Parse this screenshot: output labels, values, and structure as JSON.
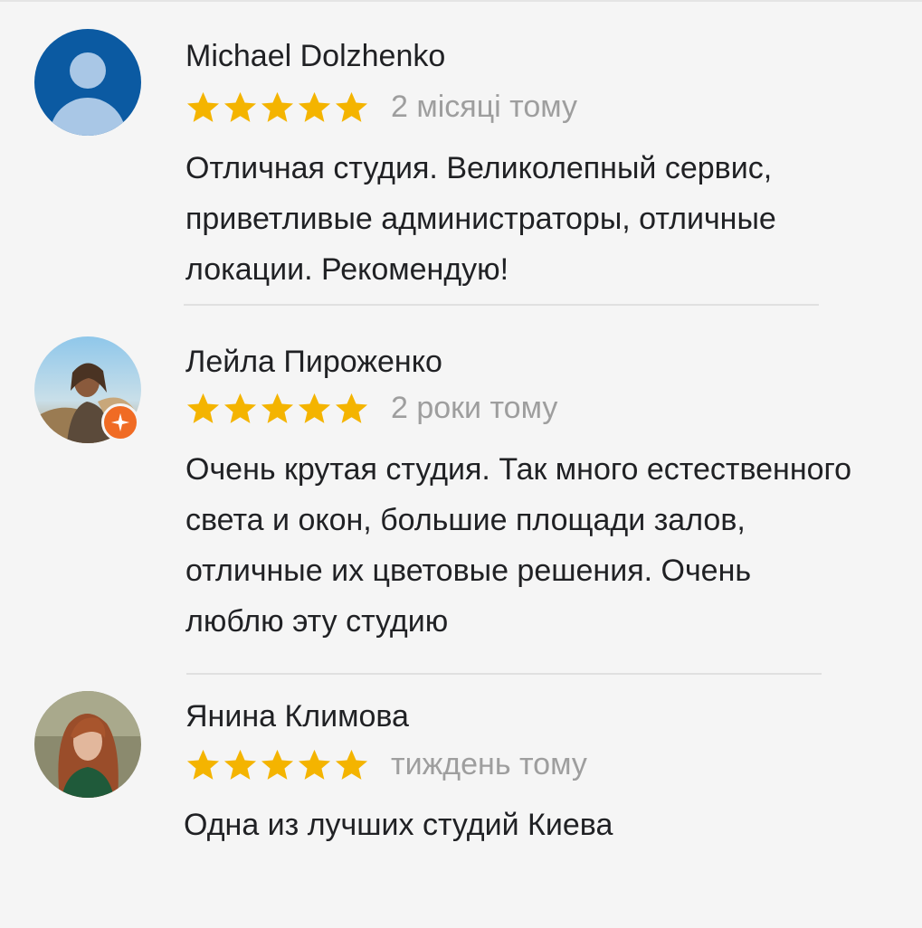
{
  "reviews": [
    {
      "author": "Michael Dolzhenko",
      "avatar": "default-user-avatar",
      "avatar_color": "#0b5aa2",
      "rating": 5,
      "date": "2 місяці тому",
      "text": "Отличная студия. Великолепный сервис, приветливые администраторы, отличные локации. Рекомендую!"
    },
    {
      "author": "Лейла Пироженко",
      "avatar": "photo-avatar",
      "local_guide_badge": true,
      "rating": 5,
      "date": "2 роки тому",
      "text": "Очень крутая студия. Так много естественного света и окон, большие площади залов, отличные их цветовые решения. Очень люблю эту студию"
    },
    {
      "author": "Янина Климова",
      "avatar": "photo-avatar",
      "rating": 5,
      "date": "тиждень тому",
      "text": "Одна из лучших студий Киева"
    }
  ],
  "colors": {
    "star": "#f4b400",
    "secondary_text": "#9e9e9e",
    "primary_text": "#202124",
    "badge": "#f06b24"
  }
}
